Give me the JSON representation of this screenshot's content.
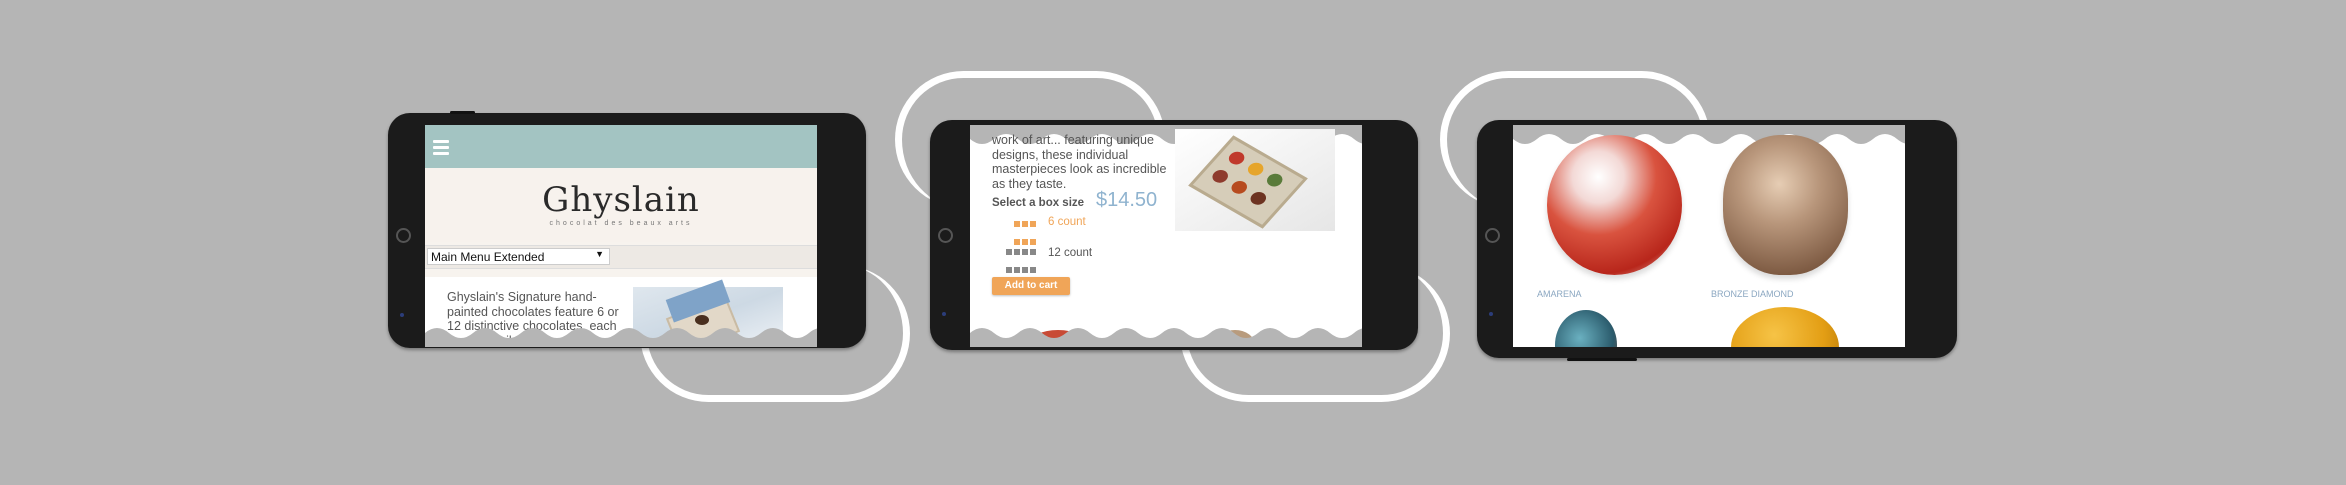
{
  "panel1": {
    "logo": "Ghyslain",
    "tagline": "chocolat des beaux arts",
    "menu_select": "Main Menu Extended",
    "description": "Ghyslain's Signature hand-painted chocolates feature 6 or 12 distinctive chocolates, each one a detailed"
  },
  "panel2": {
    "description": "work of art... featuring unique designs, these individual masterpieces look as incredible as they taste.",
    "box_size_label": "Select a box size",
    "price": "$14.50",
    "option_6": "6 count",
    "option_12": "12 count",
    "add_to_cart": "Add to cart"
  },
  "panel3": {
    "items": [
      "AMARENA",
      "BRONZE DIAMOND"
    ]
  },
  "colors": {
    "background": "#b5b5b5",
    "header_teal": "#a3c4c2",
    "accent_orange": "#f0a558",
    "price_blue": "#8fb3cf",
    "phone_body": "#1b1b1b"
  }
}
